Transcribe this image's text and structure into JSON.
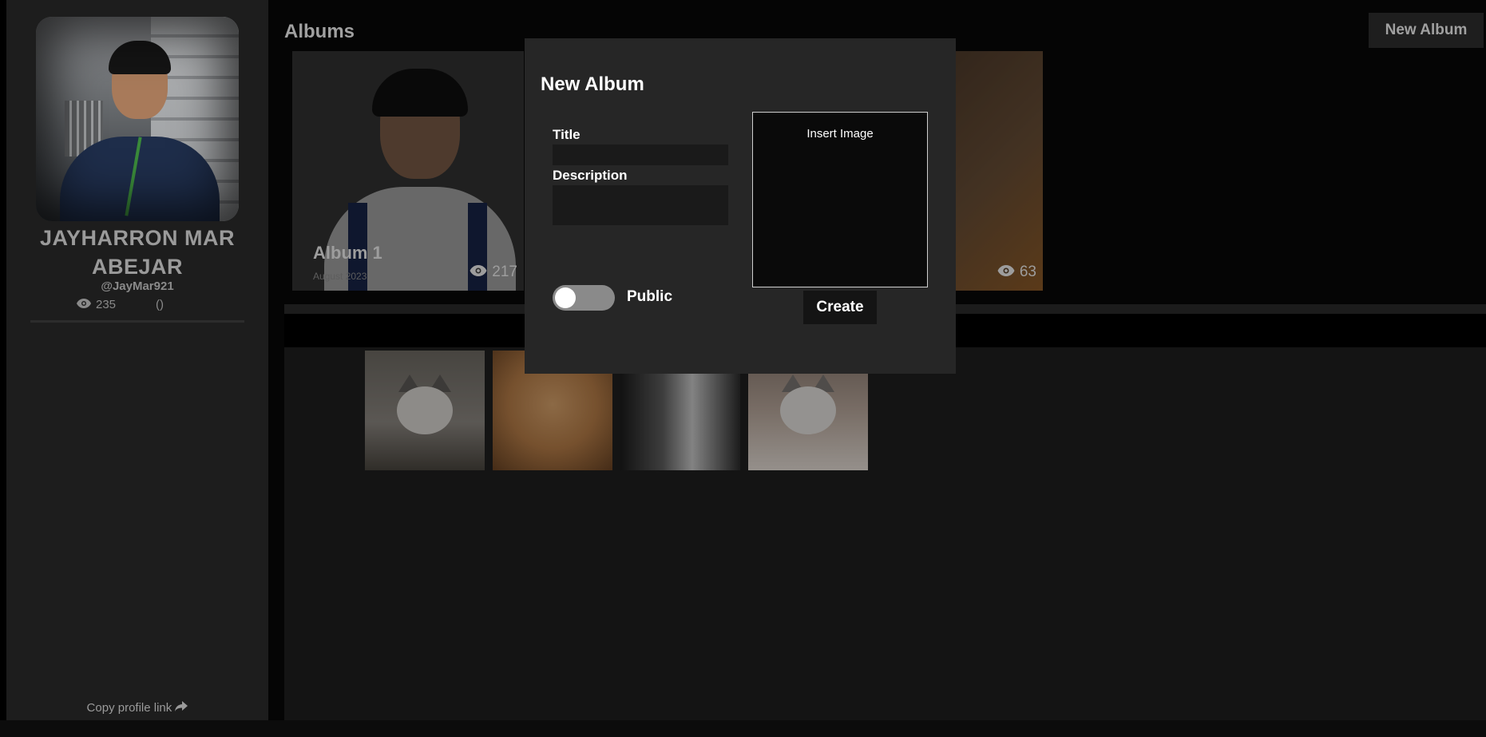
{
  "profile": {
    "name": "JAYHARRON MAR ABEJAR",
    "handle": "@JayMar921",
    "views": "235",
    "extra": "()",
    "copy_link_label": "Copy profile link"
  },
  "main": {
    "title": "Albums",
    "new_album_label": "New Album"
  },
  "albums": [
    {
      "name": "Album 1",
      "date": "August 2023",
      "views": "217"
    },
    {
      "name": "",
      "date": "",
      "views": "63"
    }
  ],
  "modal": {
    "title": "New Album",
    "title_label": "Title",
    "title_value": "",
    "description_label": "Description",
    "description_value": "",
    "public_label": "Public",
    "public_on": false,
    "insert_image_label": "Insert Image",
    "create_label": "Create"
  },
  "icons": {
    "eye": "eye-icon",
    "share": "share-arrow-icon"
  },
  "colors": {
    "sidebar_bg": "#1d1d1d",
    "modal_bg": "#262626",
    "page_bg": "#050505"
  }
}
